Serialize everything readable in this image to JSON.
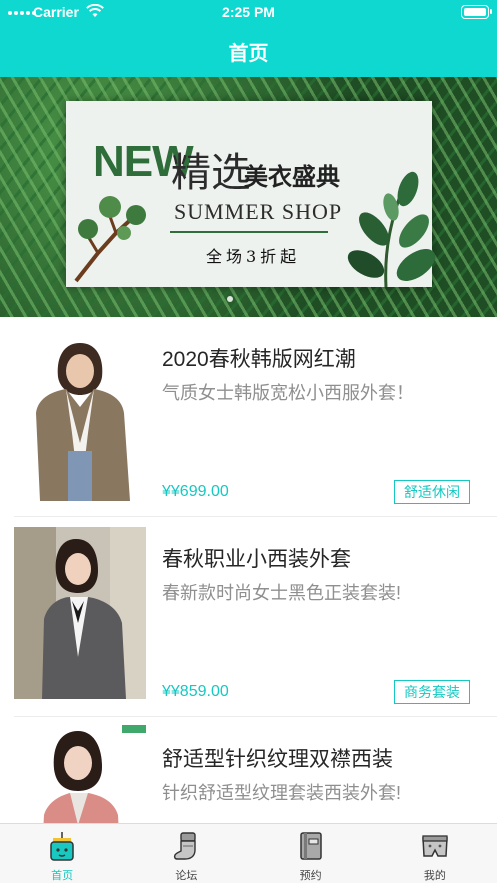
{
  "status_bar": {
    "carrier": "Carrier",
    "time": "2:25 PM"
  },
  "nav": {
    "title": "首页"
  },
  "banner": {
    "headline": "NEW",
    "title": "精选",
    "subtitle": "美衣盛典",
    "shop_name": "SUMMER SHOP",
    "promo": "全场3折起"
  },
  "products": [
    {
      "title": "2020春秋韩版网红潮",
      "desc": "气质女士韩版宽松小西服外套！",
      "price": "¥¥699.00",
      "tag": "舒适休闲"
    },
    {
      "title": "春秋职业小西装外套",
      "desc": "春新款时尚女士黑色正装套装!",
      "price": "¥¥859.00",
      "tag": "商务套装"
    },
    {
      "title": "舒适型针织纹理双襟西装",
      "desc": "针织舒适型纹理套装西装外套!",
      "price": "",
      "tag": ""
    }
  ],
  "tabbar": {
    "tabs": [
      {
        "label": "首页",
        "icon": "home-icon",
        "active": true
      },
      {
        "label": "论坛",
        "icon": "forum-icon",
        "active": false
      },
      {
        "label": "预约",
        "icon": "booking-icon",
        "active": false
      },
      {
        "label": "我的",
        "icon": "profile-icon",
        "active": false
      }
    ]
  },
  "colors": {
    "accent": "#0fd8d0",
    "price": "#16c8c2",
    "text": "#262626",
    "muted": "#8f8f8f"
  }
}
